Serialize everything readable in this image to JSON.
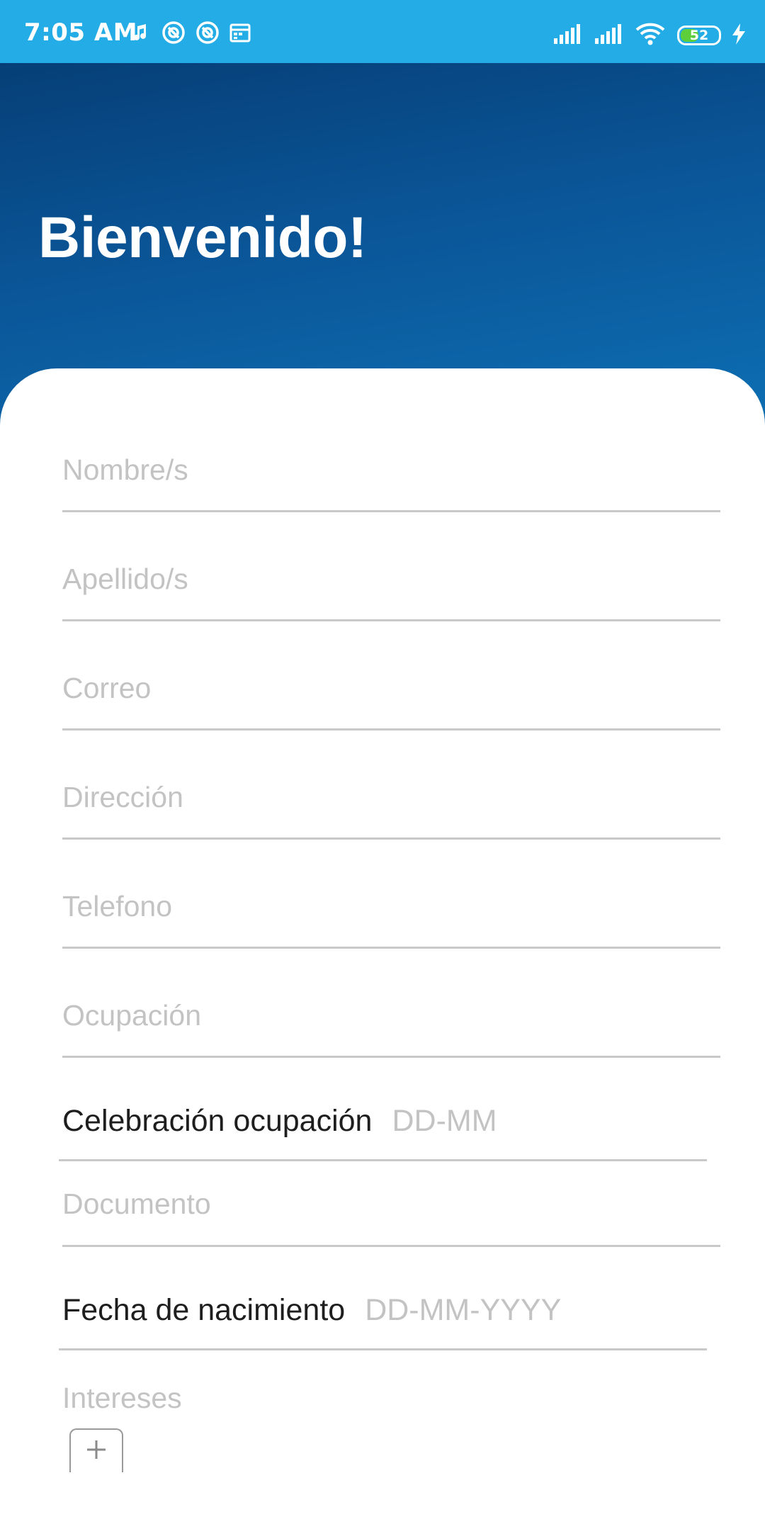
{
  "status_bar": {
    "time": "7:05 AM",
    "battery": "52",
    "battery_level": 0.52,
    "background": "#23ace5",
    "left_icons": [
      "music-note-icon",
      "app-notification-icon",
      "app-notification-icon",
      "calendar-icon"
    ],
    "right_icons": [
      "signal-icon",
      "signal-icon",
      "wifi-icon",
      "battery-icon",
      "charging-bolt-icon"
    ]
  },
  "header": {
    "title": "Bienvenido!",
    "gradient_start": "#063f77",
    "gradient_end": "#0d6fb3"
  },
  "form": {
    "nombre_placeholder": "Nombre/s",
    "apellido_placeholder": "Apellido/s",
    "correo_placeholder": "Correo",
    "direccion_placeholder": "Dirección",
    "telefono_placeholder": "Telefono",
    "ocupacion_placeholder": "Ocupación",
    "celebracion_label": "Celebración ocupación",
    "celebracion_placeholder": "DD-MM",
    "documento_placeholder": "Documento",
    "nacimiento_label": "Fecha de nacimiento",
    "nacimiento_placeholder": "DD-MM-YYYY",
    "intereses_label": "Intereses",
    "add_interest_icon": "plus-icon"
  }
}
